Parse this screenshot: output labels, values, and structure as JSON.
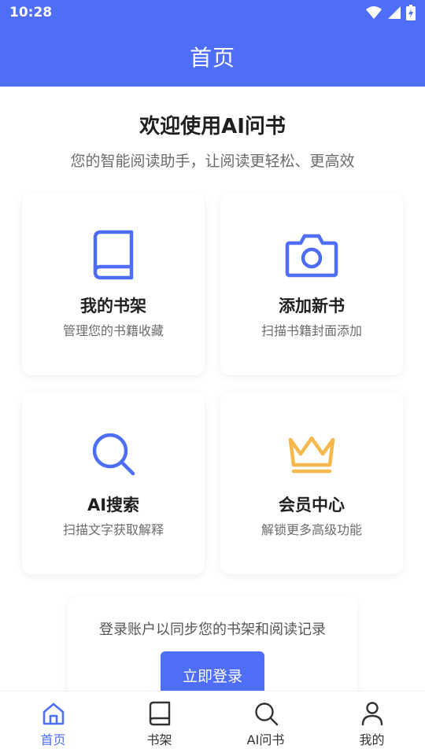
{
  "status_bar": {
    "time": "10:28"
  },
  "header": {
    "title": "首页"
  },
  "welcome": {
    "title": "欢迎使用AI问书",
    "subtitle": "您的智能阅读助手，让阅读更轻松、更高效"
  },
  "cards": [
    {
      "title": "我的书架",
      "desc": "管理您的书籍收藏",
      "icon": "book-icon"
    },
    {
      "title": "添加新书",
      "desc": "扫描书籍封面添加",
      "icon": "camera-icon"
    },
    {
      "title": "AI搜索",
      "desc": "扫描文字获取解释",
      "icon": "search-icon"
    },
    {
      "title": "会员中心",
      "desc": "解锁更多高级功能",
      "icon": "crown-icon"
    }
  ],
  "login": {
    "prompt": "登录账户以同步您的书架和阅读记录",
    "button": "立即登录"
  },
  "tabs": [
    {
      "label": "首页",
      "icon": "home-icon",
      "active": true
    },
    {
      "label": "书架",
      "icon": "book-icon",
      "active": false
    },
    {
      "label": "AI问书",
      "icon": "search-icon",
      "active": false
    },
    {
      "label": "我的",
      "icon": "user-icon",
      "active": false
    }
  ],
  "colors": {
    "primary": "#4f6ef7",
    "crown": "#f6b84a"
  }
}
